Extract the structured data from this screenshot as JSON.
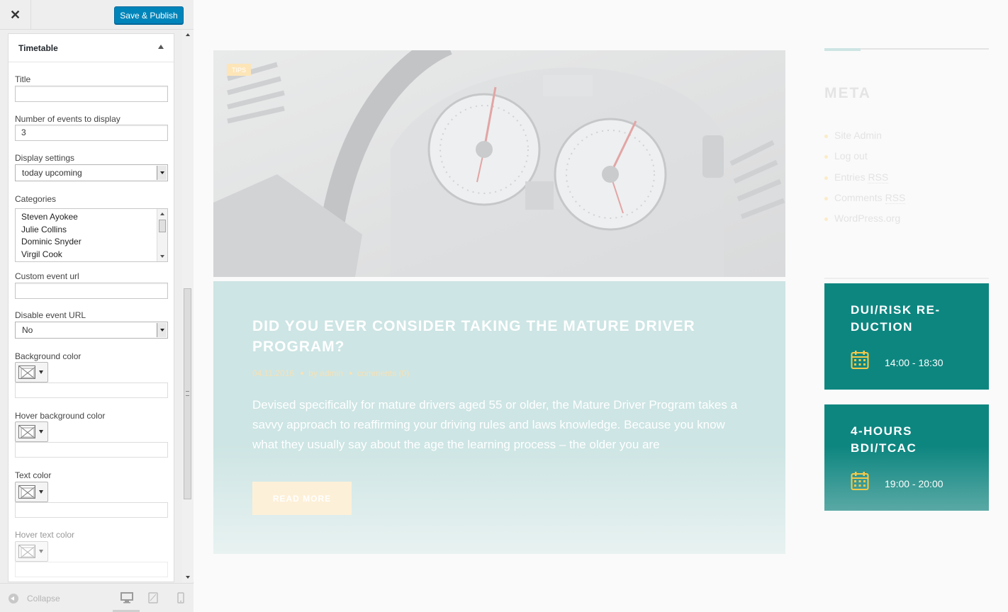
{
  "customizer": {
    "close_label": "✕",
    "save_label": "Save & Publish",
    "section_title": "Timetable",
    "fields": {
      "title_label": "Title",
      "title_value": "",
      "events_label": "Number of events to display",
      "events_value": "3",
      "display_label": "Display settings",
      "display_value": "today upcoming",
      "categories_label": "Categories",
      "categories": [
        "Steven Ayokee",
        "Julie Collins",
        "Dominic Snyder",
        "Virgil Cook"
      ],
      "custom_url_label": "Custom event url",
      "custom_url_value": "",
      "disable_url_label": "Disable event URL",
      "disable_url_value": "No",
      "bg_color_label": "Background color",
      "hover_bg_label": "Hover background color",
      "text_color_label": "Text color",
      "hover_text_label": "Hover text color"
    },
    "footer": {
      "collapse_label": "Collapse",
      "devices": [
        "desktop-icon",
        "tablet-icon",
        "mobile-icon"
      ]
    }
  },
  "preview": {
    "post": {
      "tag": "TIPS",
      "title": "Did you ever consider taking the Mature Driver Program?",
      "date": "04.11.2016",
      "author": "by admin",
      "comments": "comments (0)",
      "excerpt": "Devised specifically for mature drivers aged 55 or older, the Mature Driver Program takes a savvy approach to reaffirming your driving rules and laws knowledge. Because you know what they usually say about the age the learning process – the older you are",
      "read_more": "READ MORE"
    },
    "meta_widget": {
      "title": "META",
      "items": {
        "site_admin": "Site Admin",
        "log_out": "Log out",
        "entries": "Entries",
        "entries_rss": "RSS",
        "comments": "Comments",
        "comments_rss": "RSS",
        "wordpress": "WordPress.org"
      }
    },
    "timetable": [
      {
        "title": "DUI/Risk Re-duction",
        "time": "14:00 - 18:30"
      },
      {
        "title": "4-Hours BDI/TCAC",
        "time": "19:00 - 20:00"
      }
    ]
  },
  "colors": {
    "save_button": "#0085ba",
    "timetable_card": "#0e8680",
    "accent_yellow": "#f5c94a",
    "post_body": "#cde5e4"
  }
}
